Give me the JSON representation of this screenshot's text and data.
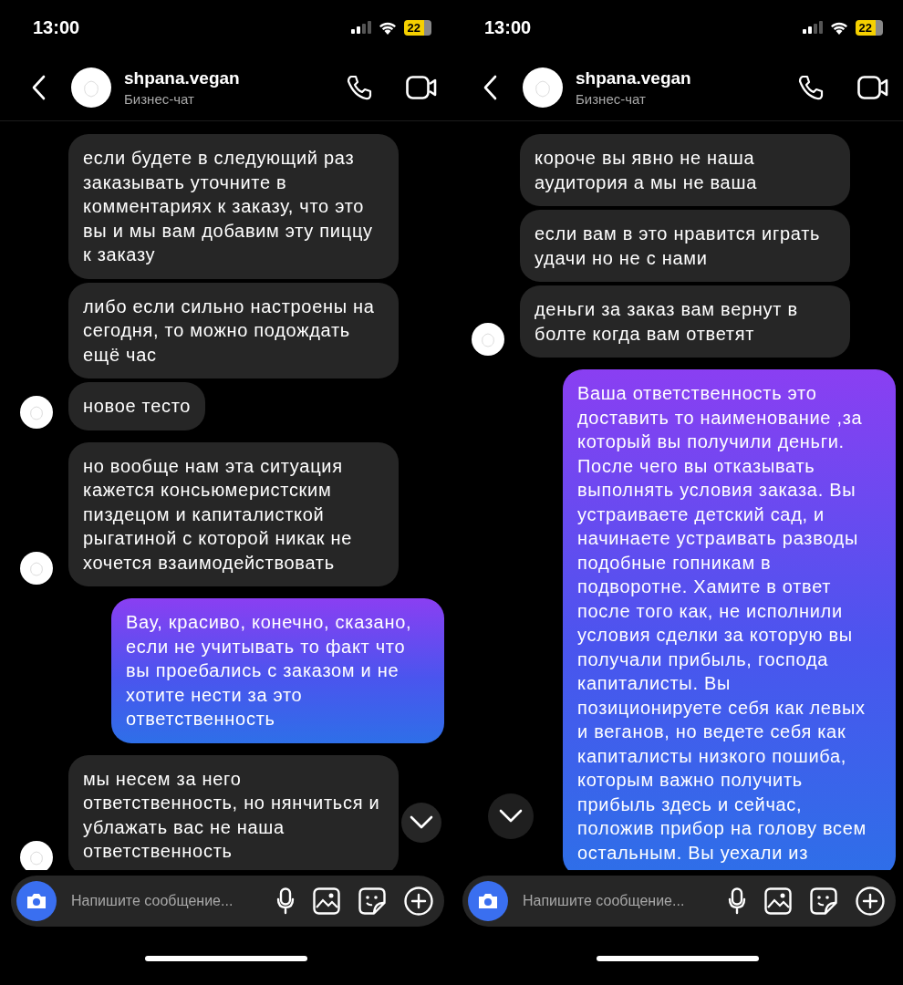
{
  "panels": [
    {
      "status_bar": {
        "time": "13:00",
        "battery": "22"
      },
      "header": {
        "name": "shpana.vegan",
        "subtitle": "Бизнес-чат"
      },
      "messages": [
        {
          "kind": "received",
          "avatar": false,
          "text": "если будете в следующий раз заказывать уточните в комментариях к заказу, что это вы и мы вам добавим эту пиццу к заказу"
        },
        {
          "kind": "received",
          "avatar": false,
          "text": "либо если сильно настроены на сегодня, то можно подождать ещё час"
        },
        {
          "kind": "received",
          "avatar": true,
          "text": "новое тесто"
        },
        {
          "kind": "received",
          "avatar": true,
          "gap": true,
          "text": "но вообще нам эта ситуация кажется консьюмеристским пиздецом и капиталисткой рыгатиной с которой никак не хочется взаимодействовать"
        },
        {
          "kind": "sent",
          "gap": true,
          "text": "Вау, красиво, конечно, сказано, если не учитывать то факт что вы проебались с заказом и не хотите нести за это ответственность"
        },
        {
          "kind": "received",
          "avatar": true,
          "gap": true,
          "text": "мы несем за него ответственность, но нянчиться и ублажать вас не наша ответственность"
        }
      ],
      "composer": {
        "placeholder": "Напишите сообщение..."
      }
    },
    {
      "status_bar": {
        "time": "13:00",
        "battery": "22"
      },
      "header": {
        "name": "shpana.vegan",
        "subtitle": "Бизнес-чат"
      },
      "messages": [
        {
          "kind": "received",
          "avatar": false,
          "text": "короче вы явно не наша аудитория а мы не ваша"
        },
        {
          "kind": "received",
          "avatar": false,
          "text": "если вам в это нравится играть удачи но не с нами"
        },
        {
          "kind": "received",
          "avatar": true,
          "text": "деньги за заказ вам вернут в болте когда вам ответят"
        },
        {
          "kind": "sent",
          "gap": true,
          "text": "Ваша ответственность это доставить то наименование ,за который вы получили деньги. После чего вы отказывать выполнять условия заказа. Вы устраиваете детский сад, и начинаете устраивать разводы подобные гопникам в подворотне. Хамите в ответ после того как, не исполнили условия сделки за которую вы получали прибыль, господа капиталисты. Вы позиционируете себя как левых и веганов, но ведете себя как капиталисты низкого пошиба, которым важно получить прибыль здесь и сейчас, положив прибор на голову всем остальным. Вы уехали из"
        }
      ],
      "composer": {
        "placeholder": "Напишите сообщение..."
      }
    }
  ]
}
